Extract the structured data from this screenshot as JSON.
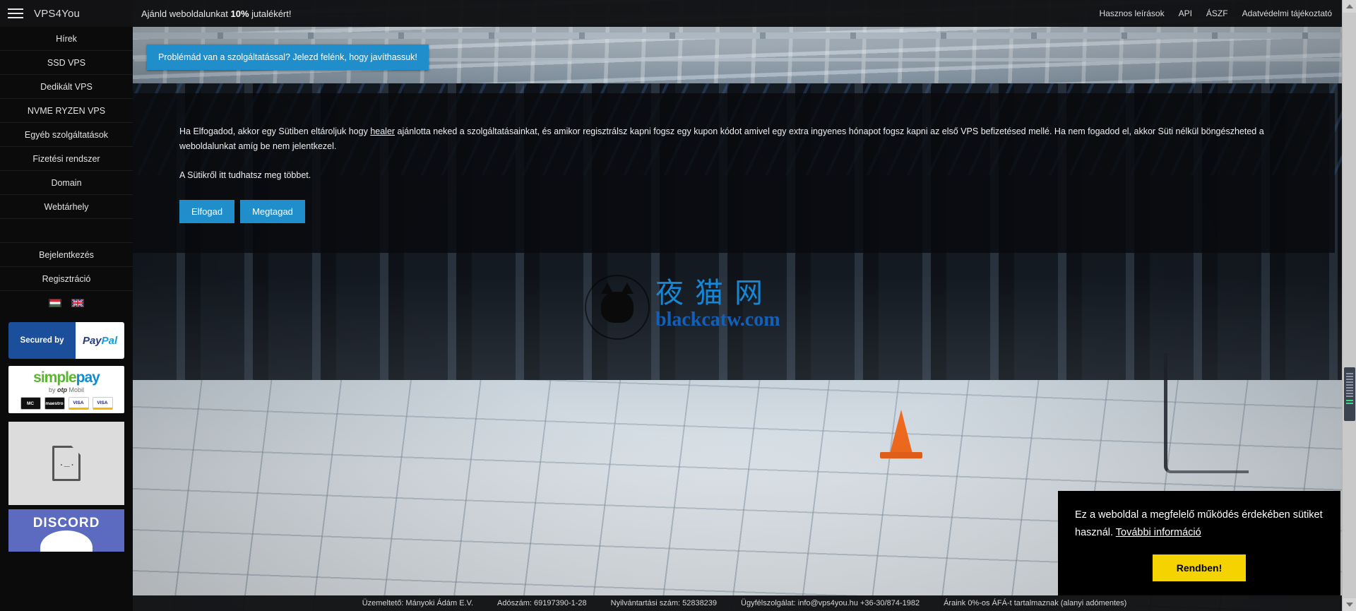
{
  "brand": {
    "name": "VPS4You",
    "menu_icon": "hamburger-icon"
  },
  "topbar": {
    "promo_prefix": "Ajánld weboldalunkat ",
    "promo_highlight": "10%",
    "promo_suffix": " jutalékért!",
    "links": [
      {
        "label": "Hasznos leírások"
      },
      {
        "label": "API"
      },
      {
        "label": "ÁSZF"
      },
      {
        "label": "Adatvédelmi tájékoztató"
      }
    ]
  },
  "sidebar": {
    "items": [
      {
        "label": "Hírek"
      },
      {
        "label": "SSD VPS"
      },
      {
        "label": "Dedikált VPS"
      },
      {
        "label": "NVME RYZEN VPS"
      },
      {
        "label": "Egyéb szolgáltatások"
      },
      {
        "label": "Fizetési rendszer"
      },
      {
        "label": "Domain"
      },
      {
        "label": "Webtárhely"
      }
    ],
    "account_items": [
      {
        "label": "Bejelentkezés"
      },
      {
        "label": "Regisztráció"
      }
    ],
    "languages": [
      {
        "name": "hungarian-flag",
        "code": "HU"
      },
      {
        "name": "english-flag",
        "code": "EN"
      }
    ],
    "paypal": {
      "secured_by": "Secured by",
      "pay": "Pay",
      "pal": "Pal"
    },
    "simplepay": {
      "simple": "simple",
      "pay": "pay",
      "by": "by",
      "otp": "otp",
      "mobil": "Mobil",
      "cards": [
        {
          "label": "MC"
        },
        {
          "label": "maestro"
        },
        {
          "label": "VISA"
        },
        {
          "label": "VISA"
        }
      ]
    },
    "discord": {
      "label": "DISCORD"
    }
  },
  "support_ribbon": {
    "text": "Problémád van a szolgáltatással? Jelezd felénk, hogy javíthassuk!"
  },
  "consent": {
    "paragraph_part1": "Ha Elfogadod, akkor egy Sütiben eltároljuk hogy ",
    "referrer_link": "healer",
    "paragraph_part2": " ajánlotta neked a szolgáltatásainkat, és amikor regisztrálsz kapni fogsz egy kupon kódot amivel egy extra ingyenes hónapot fogsz kapni az első VPS befizetésed mellé. Ha nem fogadod el, akkor Süti nélkül böngészheted a weboldalunkat amíg be nem jelentkezel.",
    "cookie_info": "A Sütikről itt tudhatsz meg többet.",
    "accept_label": "Elfogad",
    "decline_label": "Megtagad"
  },
  "watermark": {
    "cn": "夜猫网",
    "en": "blackcatw.com",
    "icon": "black-cat-icon"
  },
  "cookie_toast": {
    "message": "Ez a weboldal a megfelelő működés érdekében sütiket használ.",
    "more_link": "További információ",
    "ok_label": "Rendben!",
    "button_color": "#f5d300"
  },
  "footer": {
    "items": [
      {
        "label": "Üzemeltető: Mányoki Ádám E.V."
      },
      {
        "label": "Adószám: 69197390-1-28"
      },
      {
        "label": "Nyilvántartási szám: 52838239"
      },
      {
        "label": "Ügyfélszolgálat: info@vps4you.hu +36-30/874-1982"
      },
      {
        "label": "Áraink 0%-os ÁFÁ-t tartalmaznak (alanyi adómentes)"
      }
    ]
  },
  "colors": {
    "accent_blue": "#1f8ecb",
    "sidebar_bg": "#0b0b0c",
    "cookie_yellow": "#f5d300"
  }
}
